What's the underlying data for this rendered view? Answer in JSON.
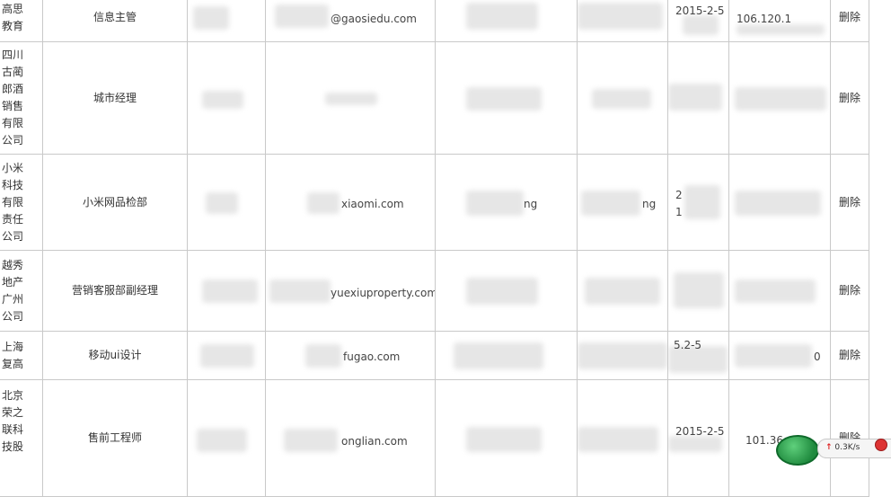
{
  "rows": [
    {
      "company": "高思教育",
      "position": "信息主管",
      "email": "@gaosiedu.com",
      "date": "2015-2-5",
      "ip": "106.120.1",
      "action": "删除"
    },
    {
      "company": "四川古蔺郎酒销售有限公司",
      "position": "城市经理",
      "email": "",
      "date": "",
      "ip": "",
      "action": "删除"
    },
    {
      "company": "小米科技有限责任公司",
      "position": "小米网品检部",
      "email": "xiaomi.com",
      "col3": "ng",
      "col4": "ng",
      "date": "2",
      "date2": "1",
      "ip": "",
      "action": "删除"
    },
    {
      "company": "越秀地产广州公司",
      "position": "营销客服部副经理",
      "email": "yuexiuproperty.com",
      "date": "",
      "ip": "",
      "action": "删除"
    },
    {
      "company": "上海复高",
      "position": "移动ui设计",
      "email": "fugao.com",
      "date": "5.2-5",
      "ip": "0",
      "action": "删除"
    },
    {
      "company": "北京荣之联科技股",
      "position": "售前工程师",
      "email": "onglian.com",
      "date": "2015-2-5",
      "ip": "101.36",
      "action": "删除"
    }
  ],
  "speed_widget": {
    "label": "0.3K/s",
    "arrow": "↑"
  }
}
